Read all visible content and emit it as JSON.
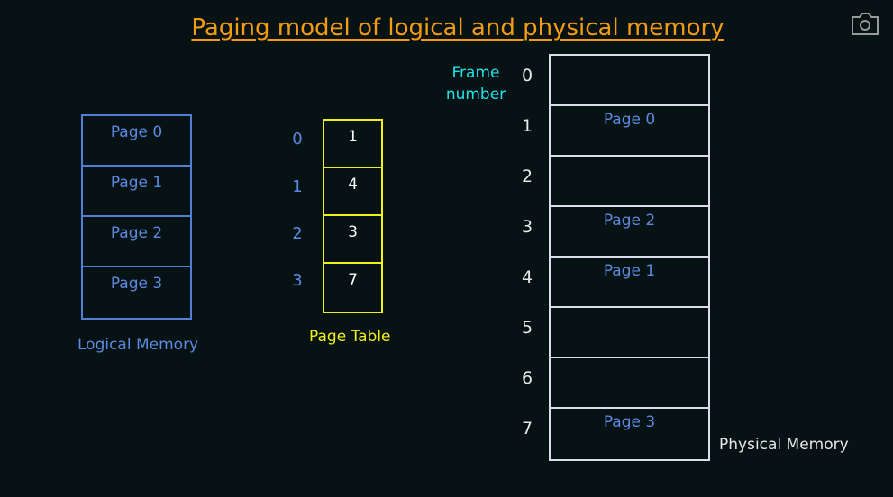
{
  "title": "Paging model of logical and physical memory",
  "logical": {
    "label": "Logical Memory",
    "pages": [
      "Page 0",
      "Page 1",
      "Page 2",
      "Page 3"
    ]
  },
  "page_table": {
    "label": "Page Table",
    "indices": [
      "0",
      "1",
      "2",
      "3"
    ],
    "frames": [
      "1",
      "4",
      "3",
      "7"
    ]
  },
  "physical": {
    "label": "Physical Memory",
    "frame_header": "Frame number",
    "frame_numbers": [
      "0",
      "1",
      "2",
      "3",
      "4",
      "5",
      "6",
      "7"
    ],
    "contents": [
      "",
      "Page 0",
      "",
      "Page 2",
      "Page 1",
      "",
      "",
      "Page 3"
    ]
  },
  "icons": {
    "camera": "camera-icon"
  }
}
